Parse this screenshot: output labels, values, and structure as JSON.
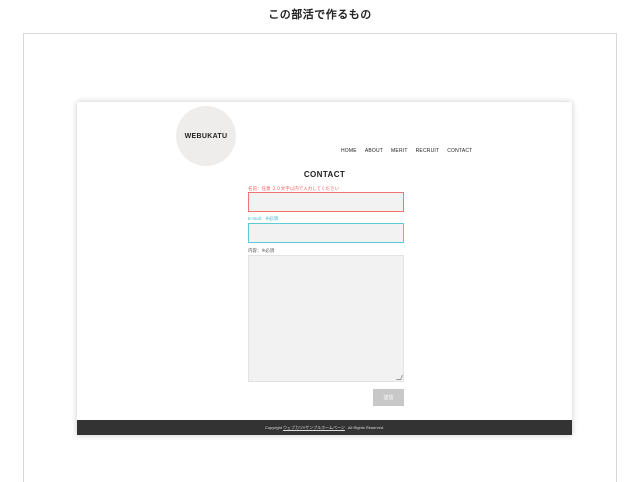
{
  "heading": "この部活で作るもの",
  "logo": "WEBUKATU",
  "nav": {
    "items": [
      "HOME",
      "ABOUT",
      "MERIT",
      "RECRUIT",
      "CONTACT"
    ]
  },
  "contact": {
    "title": "CONTACT",
    "name_label": "名前：任意 ２０文字以内で入力してください",
    "email_label": "E-mail：※必須",
    "message_label": "内容：※必須",
    "name_value": "",
    "email_value": "",
    "message_value": "",
    "submit_label": "送信"
  },
  "footer": {
    "prefix": "Copyright",
    "link_text": "ウェブカツ!!サンプルホームページ",
    "suffix": ". All Rights Reserved."
  },
  "colors": {
    "error": "#f15b5b",
    "ok": "#33b9cf",
    "footer_bg": "#333333",
    "button_bg": "#c8c8c8"
  }
}
